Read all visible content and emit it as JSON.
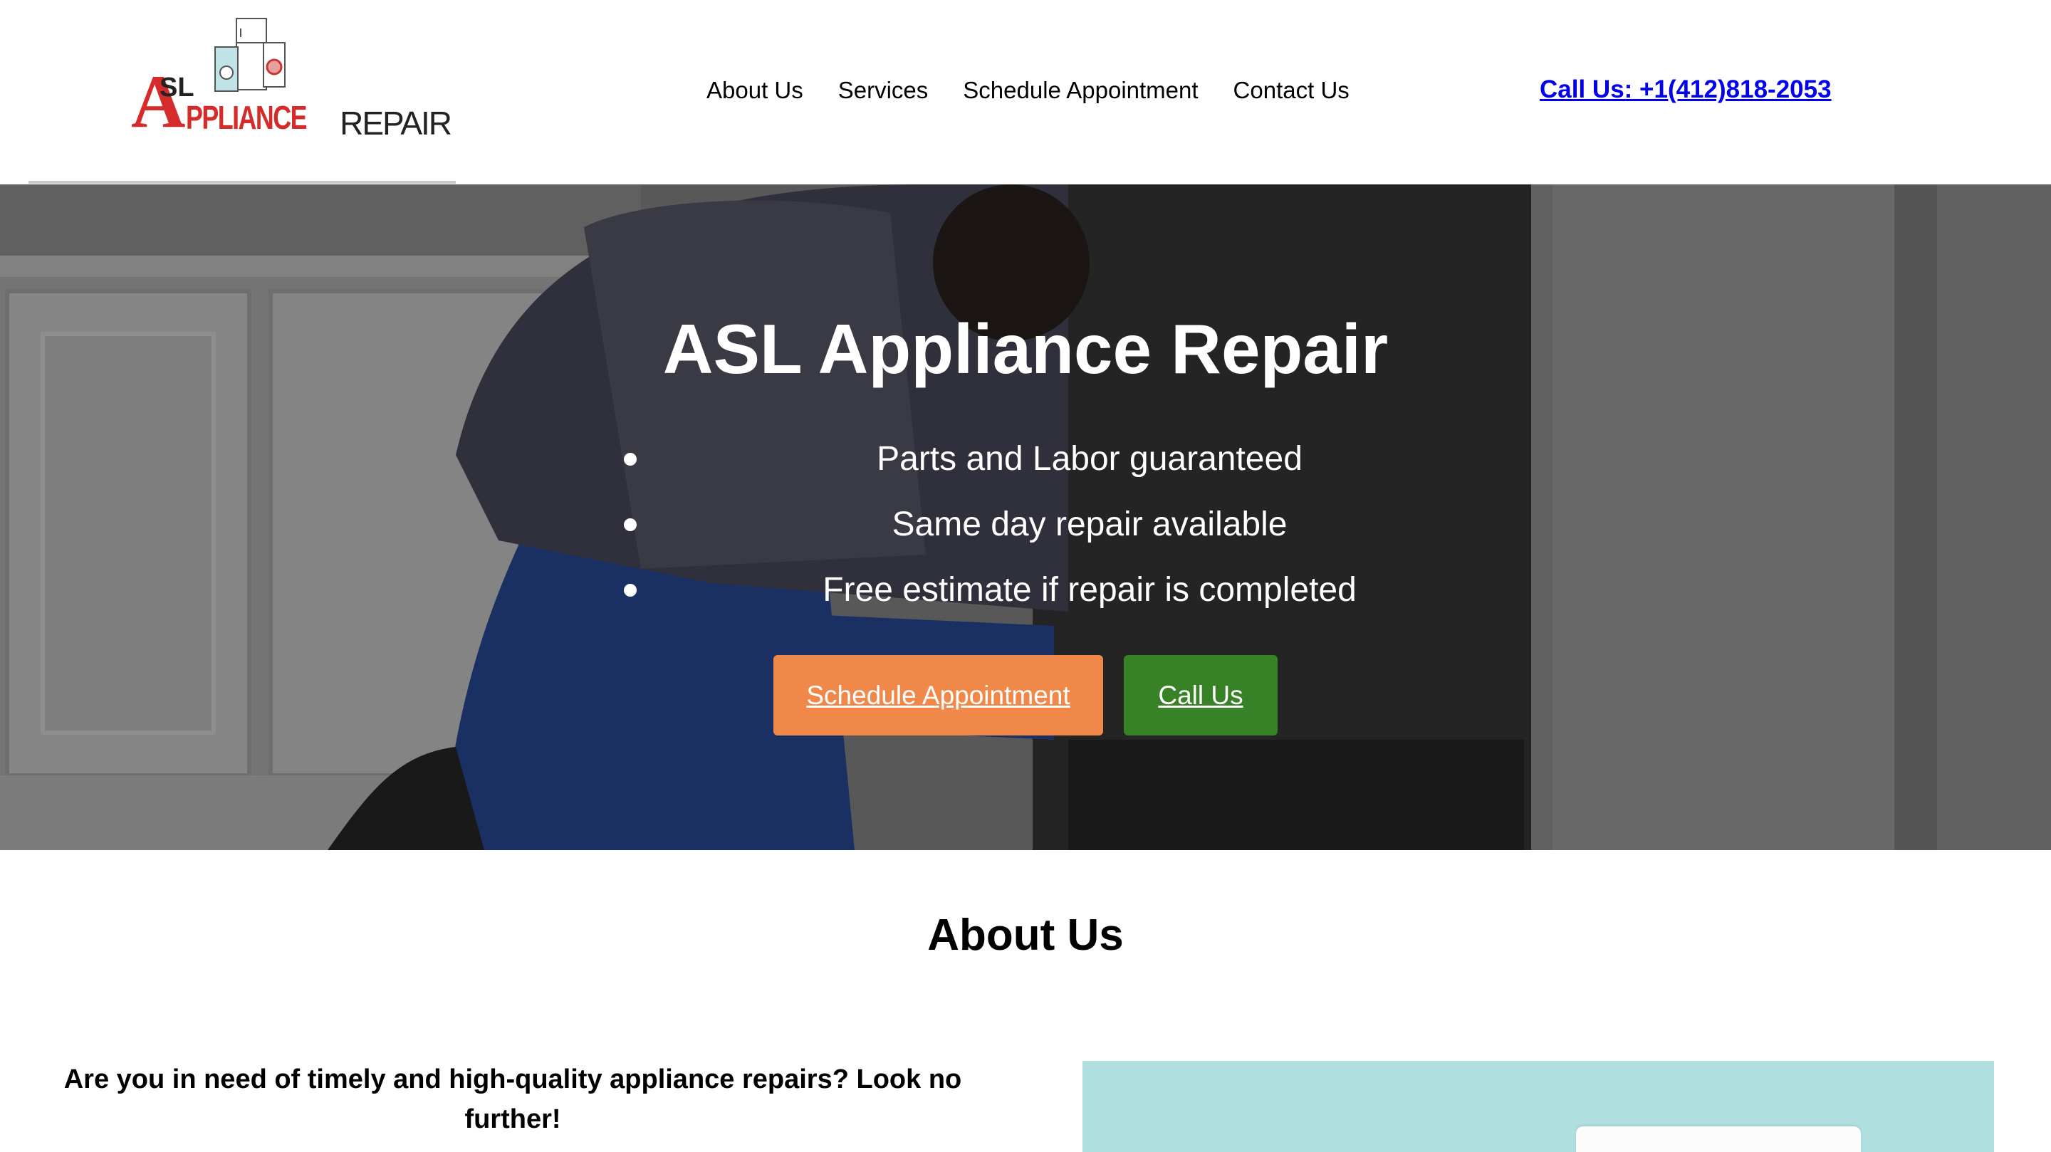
{
  "header": {
    "logo": {
      "text_a": "A",
      "text_sl": "SL",
      "text_ppliance": "PPLIANCE",
      "text_repair": "REPAIR",
      "brand_red": "#d52b2b"
    },
    "nav": [
      {
        "label": "About Us"
      },
      {
        "label": "Services"
      },
      {
        "label": "Schedule Appointment"
      },
      {
        "label": "Contact Us"
      }
    ],
    "call_link": "Call Us: +1(412)818-2053",
    "link_color": "#0000ee"
  },
  "hero": {
    "title": "ASL Appliance Repair",
    "bullets": [
      "Parts and Labor guaranteed",
      "Same day repair available",
      "Free estimate if repair is completed"
    ],
    "buttons": {
      "schedule": "Schedule Appointment",
      "call": "Call Us"
    },
    "colors": {
      "schedule": "#f0884a",
      "call": "#378126"
    }
  },
  "about": {
    "title": "About Us",
    "text": "Are you in need of timely and high-quality appliance repairs? Look no further!",
    "image_bg": "#b0dfe0"
  }
}
